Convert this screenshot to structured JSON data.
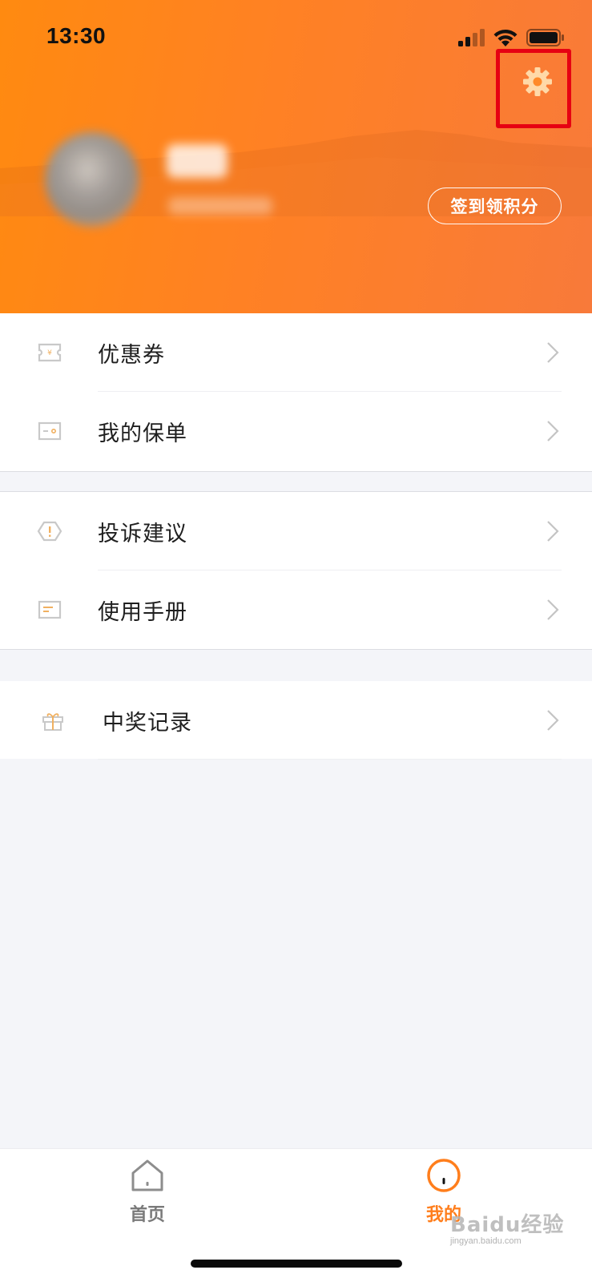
{
  "status_bar": {
    "time": "13:30"
  },
  "header": {
    "checkin_label": "签到领积分",
    "settings_icon": "gear-icon",
    "highlight_color": "#e60012",
    "gradient_colors": [
      "#ff8a10",
      "#f87a3a"
    ]
  },
  "menu": {
    "group1": [
      {
        "label": "优惠券",
        "icon": "coupon-icon"
      },
      {
        "label": "我的保单",
        "icon": "policy-icon"
      }
    ],
    "group2": [
      {
        "label": "投诉建议",
        "icon": "complaint-icon"
      },
      {
        "label": "使用手册",
        "icon": "manual-icon"
      }
    ],
    "group3": [
      {
        "label": "中奖记录",
        "icon": "gift-icon"
      }
    ]
  },
  "tabbar": {
    "home_label": "首页",
    "mine_label": "我的",
    "active_color": "#ff7e1c",
    "inactive_color": "#7a7a7a"
  },
  "watermark": {
    "main": "Baidu经验",
    "sub": "jingyan.baidu.com"
  }
}
